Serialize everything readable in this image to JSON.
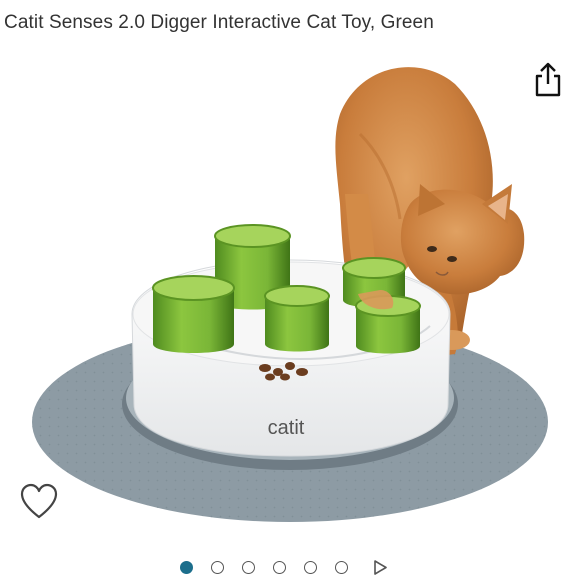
{
  "product": {
    "title": "Catit Senses 2.0 Digger Interactive Cat Toy, Green",
    "logo_text": "catit",
    "image_icon": "product-photo-cat-digger-toy"
  },
  "actions": {
    "share_icon": "share-icon",
    "wishlist_icon": "heart-outline-icon"
  },
  "carousel": {
    "total_images": 6,
    "current_index": 1,
    "next_icon": "play-triangle-icon"
  },
  "colors": {
    "accent": "#1c6e8c",
    "mat": "#8d9ba4",
    "cup_green": "#6aa82f"
  }
}
